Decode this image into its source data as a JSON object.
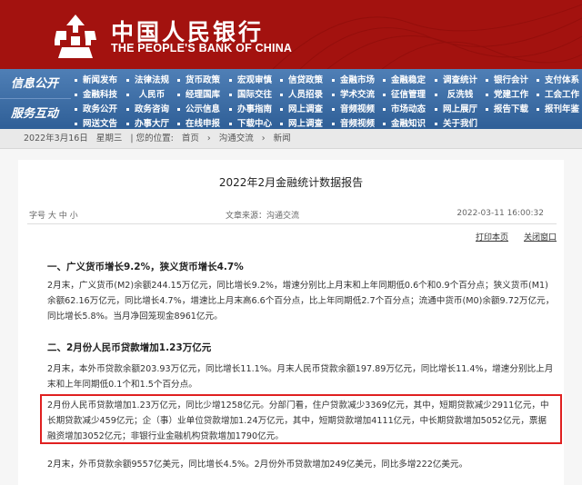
{
  "brand": {
    "title_cn": "中国人民银行",
    "title_en": "THE PEOPLE'S BANK OF CHINA",
    "colors": {
      "header_red": "#a3120f",
      "nav_blue": "#3c6aa3",
      "highlight_red": "#e02020"
    },
    "logo_icon": "pboc-emblem-icon"
  },
  "nav": {
    "section1": "信息公开",
    "section2": "服务互动",
    "rows": [
      [
        "新闻发布",
        "法律法规",
        "货币政策",
        "宏观审慎",
        "信贷政策",
        "金融市场",
        "金融稳定",
        "调查统计",
        "银行会计",
        "支付体系"
      ],
      [
        "金融科技",
        "人民币",
        "经理国库",
        "国际交往",
        "人员招录",
        "学术交流",
        "征信管理",
        "反洗钱",
        "党建工作",
        "工会工作"
      ],
      [
        "政务公开",
        "政务咨询",
        "公示信息",
        "办事指南",
        "网上调查",
        "音频视频",
        "市场动态",
        "网上展厅",
        "报告下载",
        "报刊年鉴"
      ],
      [
        "网送文告",
        "办事大厅",
        "在线申报",
        "下载中心",
        "网上调查",
        "音频视频",
        "金融知识",
        "关于我们"
      ]
    ]
  },
  "breadcrumb": {
    "date": "2022年3月16日",
    "weekday": "星期三",
    "prefix": "| 您的位置:",
    "home": "首页",
    "sep1": "›",
    "level1": "沟通交流",
    "sep2": "›",
    "level2": "新闻"
  },
  "article": {
    "title": "2022年2月金融统计数据报告",
    "font_size_label": "字号",
    "font_sizes": [
      "大",
      "中",
      "小"
    ],
    "source": "文章来源：沟通交流",
    "datetime": "2022-03-11 16:00:32",
    "print": "打印本页",
    "close": "关闭窗口",
    "sections": [
      {
        "heading": "一、广义货币增长9.2%，狭义货币增长4.7%",
        "paragraphs": [
          "2月末，广义货币(M2)余额244.15万亿元，同比增长9.2%，增速分别比上月末和上年同期低0.6个和0.9个百分点；狭义货币(M1)余额62.16万亿元，同比增长4.7%，增速比上月末高6.6个百分点，比上年同期低2.7个百分点；流通中货币(M0)余额9.72万亿元，同比增长5.8%。当月净回笼现金8961亿元。"
        ]
      },
      {
        "heading": "二、2月份人民币贷款增加1.23万亿元",
        "paragraphs": [
          "2月末，本外币贷款余额203.93万亿元，同比增长11.1%。月末人民币贷款余额197.89万亿元，同比增长11.4%，增速分别比上月末和上年同期低0.1个和1.5个百分点。",
          "2月份人民币贷款增加1.23万亿元，同比少增1258亿元。分部门看，住户贷款减少3369亿元，其中，短期贷款减少2911亿元，中长期贷款减少459亿元；企（事）业单位贷款增加1.24万亿元，其中，短期贷款增加4111亿元，中长期贷款增加5052亿元，票据融资增加3052亿元；非银行业金融机构贷款增加1790亿元。",
          "2月末，外币贷款余额9557亿美元，同比增长4.5%。2月份外币贷款增加249亿美元，同比多增222亿美元。"
        ]
      }
    ]
  }
}
